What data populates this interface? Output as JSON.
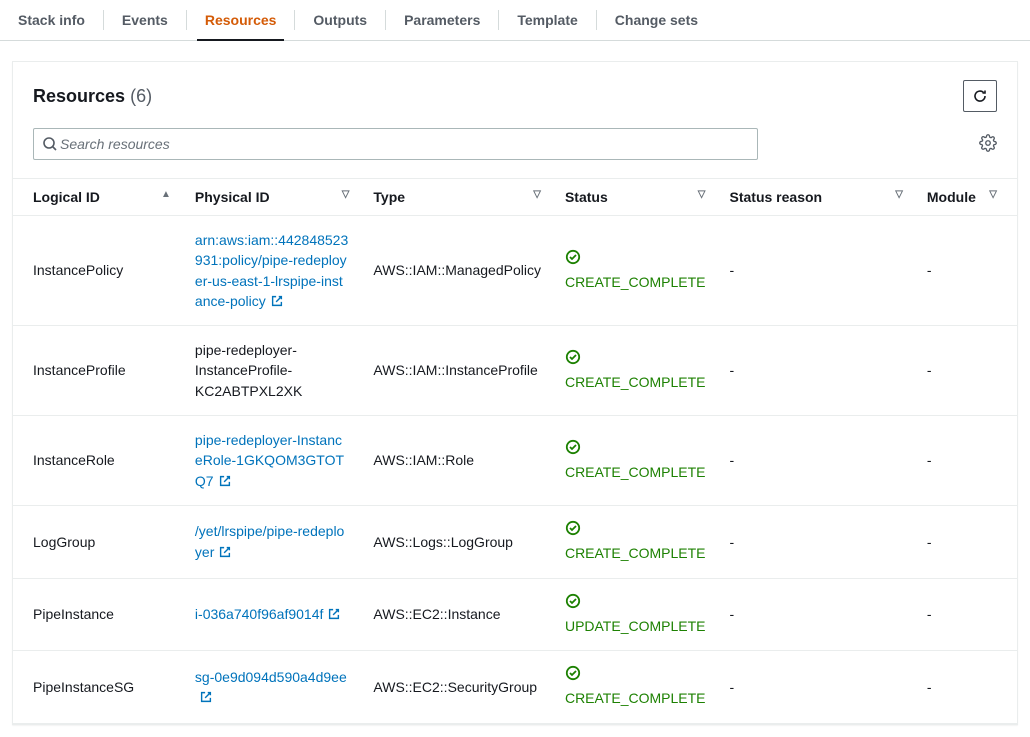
{
  "tabs": [
    {
      "label": "Stack info",
      "active": false
    },
    {
      "label": "Events",
      "active": false
    },
    {
      "label": "Resources",
      "active": true
    },
    {
      "label": "Outputs",
      "active": false
    },
    {
      "label": "Parameters",
      "active": false
    },
    {
      "label": "Template",
      "active": false
    },
    {
      "label": "Change sets",
      "active": false
    }
  ],
  "panel": {
    "title": "Resources",
    "count": "(6)"
  },
  "search": {
    "placeholder": "Search resources"
  },
  "columns": {
    "logical": "Logical ID",
    "physical": "Physical ID",
    "type": "Type",
    "status": "Status",
    "reason": "Status reason",
    "module": "Module"
  },
  "rows": [
    {
      "logical": "InstancePolicy",
      "physical": "arn:aws:iam::442848523931:policy/pipe-redeployer-us-east-1-lrspipe-instance-policy",
      "physical_link": true,
      "type": "AWS::IAM::ManagedPolicy",
      "status": "CREATE_COMPLETE",
      "reason": "-",
      "module": "-"
    },
    {
      "logical": "InstanceProfile",
      "physical": "pipe-redeployer-InstanceProfile-KC2ABTPXL2XK",
      "physical_link": false,
      "type": "AWS::IAM::InstanceProfile",
      "status": "CREATE_COMPLETE",
      "reason": "-",
      "module": "-"
    },
    {
      "logical": "InstanceRole",
      "physical": "pipe-redeployer-InstanceRole-1GKQOM3GTOTQ7",
      "physical_link": true,
      "type": "AWS::IAM::Role",
      "status": "CREATE_COMPLETE",
      "reason": "-",
      "module": "-"
    },
    {
      "logical": "LogGroup",
      "physical": "/yet/lrspipe/pipe-redeployer",
      "physical_link": true,
      "type": "AWS::Logs::LogGroup",
      "status": "CREATE_COMPLETE",
      "reason": "-",
      "module": "-"
    },
    {
      "logical": "PipeInstance",
      "physical": "i-036a740f96af9014f",
      "physical_link": true,
      "type": "AWS::EC2::Instance",
      "status": "UPDATE_COMPLETE",
      "reason": "-",
      "module": "-"
    },
    {
      "logical": "PipeInstanceSG",
      "physical": "sg-0e9d094d590a4d9ee",
      "physical_link": true,
      "type": "AWS::EC2::SecurityGroup",
      "status": "CREATE_COMPLETE",
      "reason": "-",
      "module": "-"
    }
  ]
}
